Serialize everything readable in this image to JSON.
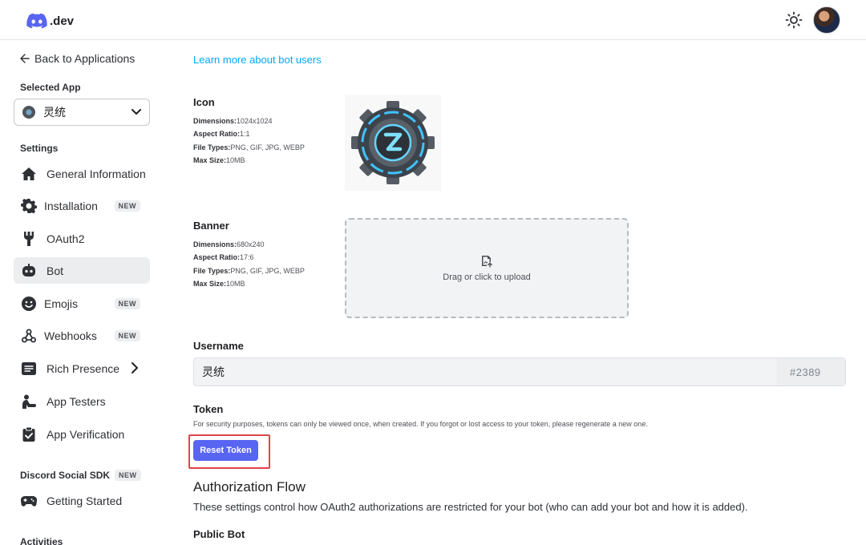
{
  "topbar": {
    "logo_text": ".dev",
    "logo_icon": "discord-icon",
    "theme_icon": "sun-icon",
    "avatar_icon": "user-avatar"
  },
  "sidebar": {
    "back_label": "Back to Applications",
    "selected_app_label": "Selected App",
    "selected_app_value": "灵统",
    "settings_label": "Settings",
    "items": [
      {
        "label": "General Information",
        "icon": "home-icon"
      },
      {
        "label": "Installation",
        "icon": "gear-icon",
        "badge": "NEW"
      },
      {
        "label": "OAuth2",
        "icon": "wrench-icon"
      },
      {
        "label": "Bot",
        "icon": "bot-icon",
        "active": true
      },
      {
        "label": "Emojis",
        "icon": "smile-icon",
        "badge": "NEW"
      },
      {
        "label": "Webhooks",
        "icon": "webhook-icon",
        "badge": "NEW"
      },
      {
        "label": "Rich Presence",
        "icon": "list-icon"
      },
      {
        "label": "App Testers",
        "icon": "tester-icon"
      },
      {
        "label": "App Verification",
        "icon": "clipboard-check-icon"
      }
    ],
    "social_sdk_label": "Discord Social SDK",
    "social_sdk_badge": "NEW",
    "getting_started_label": "Getting Started",
    "activities_label": "Activities"
  },
  "main": {
    "learn_more_link": "Learn more about bot users",
    "icon": {
      "title": "Icon",
      "dimensions_label": "Dimensions:",
      "dimensions": "1024x1024",
      "aspect_label": "Aspect Ratio:",
      "aspect": "1:1",
      "types_label": "File Types:",
      "types": "PNG, GIF, JPG, WEBP",
      "size_label": "Max Size:",
      "size": "10MB"
    },
    "banner": {
      "title": "Banner",
      "dimensions_label": "Dimensions:",
      "dimensions": "680x240",
      "aspect_label": "Aspect Ratio:",
      "aspect": "17:6",
      "types_label": "File Types:",
      "types": "PNG, GIF, JPG, WEBP",
      "size_label": "Max Size:",
      "size": "10MB",
      "upload_text": "Drag or click to upload"
    },
    "username": {
      "title": "Username",
      "value": "灵统",
      "discriminator": "#2389"
    },
    "token": {
      "title": "Token",
      "description": "For security purposes, tokens can only be viewed once, when created. If you forgot or lost access to your token, please regenerate a new one.",
      "reset_label": "Reset Token"
    },
    "auth_flow": {
      "heading": "Authorization Flow",
      "description": "These settings control how OAuth2 authorizations are restricted for your bot (who can add your bot and how it is added).",
      "public_bot_label": "Public Bot"
    }
  },
  "colors": {
    "accent": "#5865f2",
    "link": "#00a8fc",
    "highlight": "#e1434b"
  }
}
